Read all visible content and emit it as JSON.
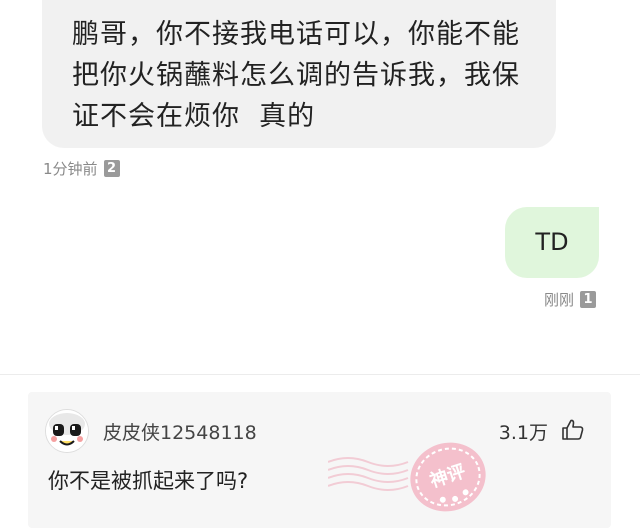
{
  "chat": {
    "incoming": {
      "lines": [
        "鹏哥，你不接我电话可以，你能不能",
        "把你火锅蘸料怎么调的告诉我，我保",
        "证不会在烦你  真的"
      ],
      "time": "1分钟前",
      "count": "2"
    },
    "outgoing": {
      "text": "TD",
      "time": "刚刚",
      "count": "1"
    }
  },
  "comment": {
    "username": "皮皮侠12548118",
    "likes": "3.1万",
    "text": "你不是被抓起来了吗?",
    "stamp_text": "神评",
    "like_icon": "thumbs-up-icon",
    "stamp_color": "#f3b6c4"
  }
}
